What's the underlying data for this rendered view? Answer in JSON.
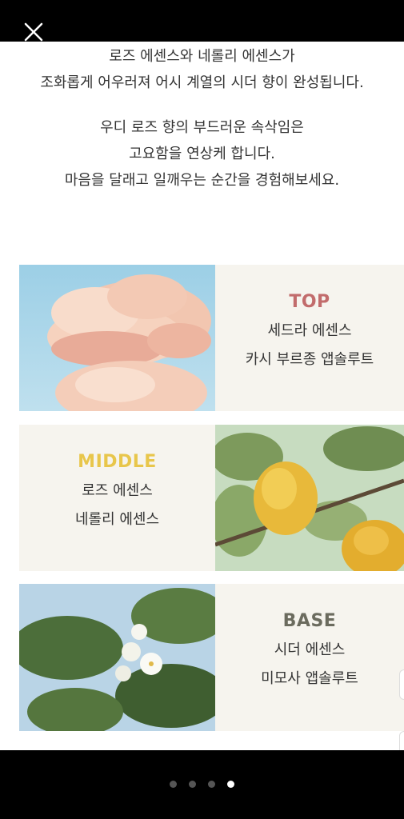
{
  "text": {
    "para1": [
      "로즈 에센스와 네롤리 에센스가",
      "조화롭게 어우러져 어시 계열의 시더 향이 완성됩니다."
    ],
    "para2": [
      "우디 로즈 향의 부드러운 속삭임은",
      "고요함을 연상케 합니다.",
      "마음을 달래고 일깨우는 순간을 경험해보세요."
    ]
  },
  "notes": [
    {
      "title": "TOP",
      "title_color": "#c26c6c",
      "lines": [
        "세드라 에센스",
        "카시 부르종 앱솔루트"
      ],
      "image": "pink-rose"
    },
    {
      "title": "MIDDLE",
      "title_color": "#e8c64b",
      "lines": [
        "로즈 에센스",
        "네롤리 에센스"
      ],
      "image": "lemon-tree"
    },
    {
      "title": "BASE",
      "title_color": "#6b6b5e",
      "lines": [
        "시더 에센스",
        "미모사 앱솔루트"
      ],
      "image": "neroli-blossom"
    }
  ],
  "icons": {
    "close": "close-icon"
  },
  "pager": {
    "count": 4,
    "active": 3
  }
}
